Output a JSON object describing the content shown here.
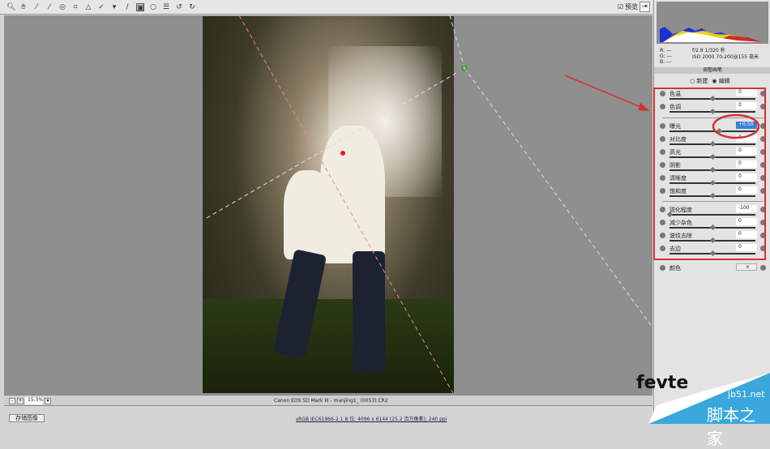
{
  "toolbar": {
    "tools": [
      "zoom-tool",
      "hand-tool",
      "white-balance-tool",
      "color-sampler-tool",
      "target-adjustment-tool",
      "crop-tool",
      "straighten-tool",
      "spot-removal-tool",
      "red-eye-tool",
      "adjustment-brush-tool",
      "graduated-filter-tool",
      "radial-filter-tool",
      "preferences",
      "rotate-left",
      "rotate-right"
    ],
    "preview_label": "预览",
    "preview_checked": true
  },
  "canvas": {
    "zoom": "15.3%",
    "filename": "Canon EOS 5D Mark III - manjing1_ (0053).CR2"
  },
  "footer": {
    "save_label": "存储图像",
    "status": "sRGB IEC61966-2.1 8 位; 4096 x 6144 (25.2 百万像素); 240 ppi"
  },
  "info": {
    "r": "R: ---",
    "g": "G: ---",
    "b": "B: ---",
    "exposure": "f/2.8  1/320 秒",
    "iso": "ISO 2000  70-200@155 毫米"
  },
  "panel": {
    "title": "调整画笔",
    "new_label": "新建",
    "edit_label": "编辑",
    "mode": "编辑",
    "sliders": [
      {
        "label": "色温",
        "value": "0",
        "pos": 0.5
      },
      {
        "label": "色调",
        "value": "0",
        "pos": 0.5
      },
      {
        "label": "曝光",
        "value": "+0.50",
        "pos": 0.58,
        "highlighted": true
      },
      {
        "label": "对比度",
        "value": "0",
        "pos": 0.5
      },
      {
        "label": "高光",
        "value": "0",
        "pos": 0.5
      },
      {
        "label": "阴影",
        "value": "0",
        "pos": 0.5
      },
      {
        "label": "清晰度",
        "value": "0",
        "pos": 0.5
      },
      {
        "label": "饱和度",
        "value": "0",
        "pos": 0.5
      },
      {
        "label": "锐化程度",
        "value": "-100",
        "pos": 0.0
      },
      {
        "label": "减少杂色",
        "value": "0",
        "pos": 0.5
      },
      {
        "label": "波纹去除",
        "value": "0",
        "pos": 0.5
      },
      {
        "label": "去边",
        "value": "0",
        "pos": 0.5
      }
    ],
    "color_label": "颜色"
  },
  "watermark": {
    "brand": "fevte",
    "site": "jb51.net",
    "site_cn": "脚本之家"
  },
  "colors": {
    "annotation": "#d8302f",
    "accent": "#3b7fd6"
  }
}
